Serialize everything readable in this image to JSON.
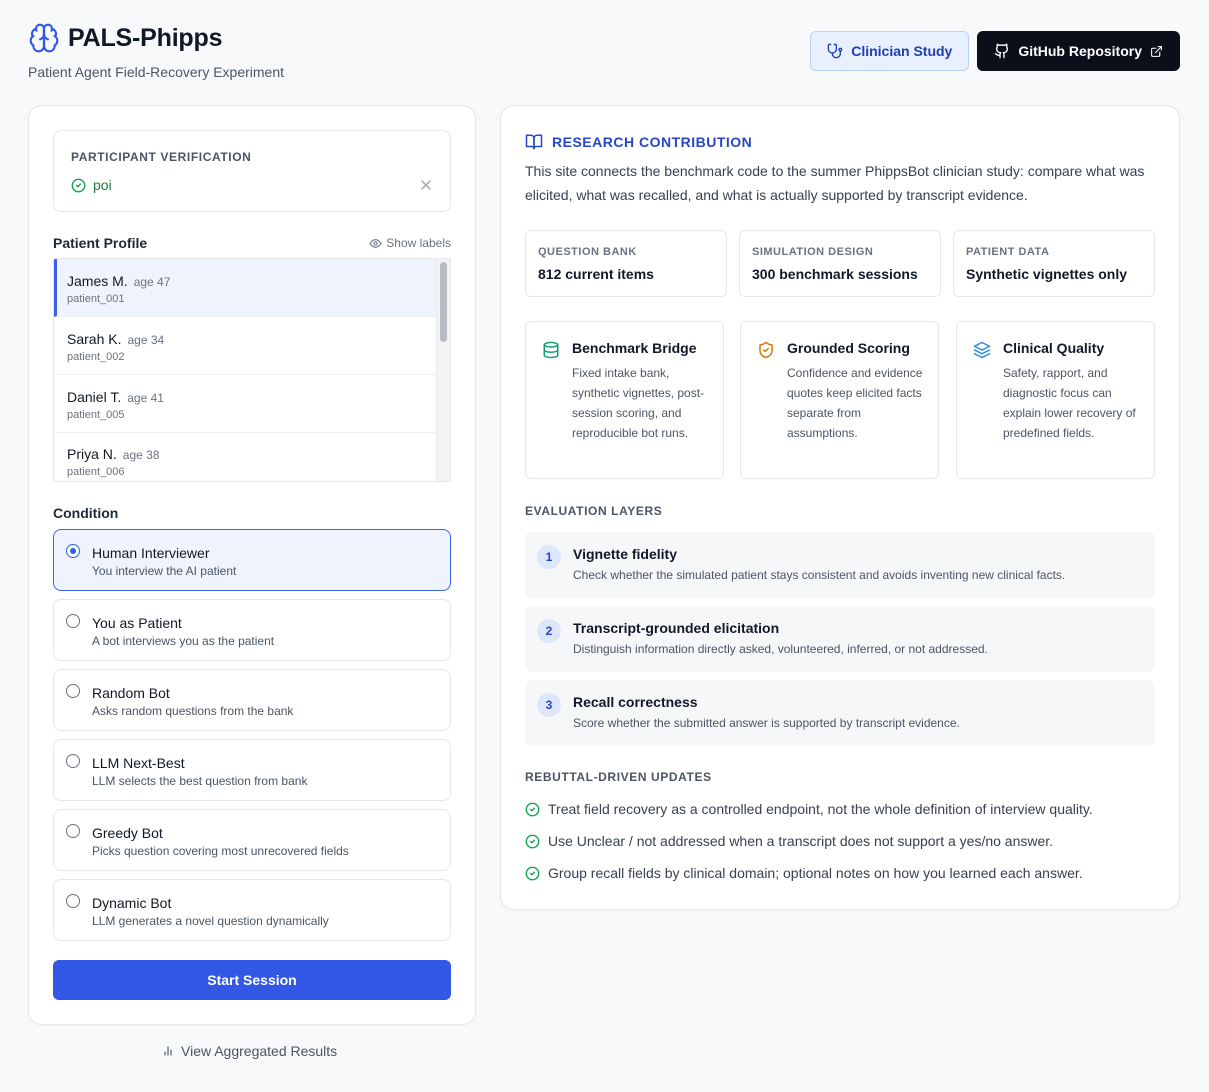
{
  "header": {
    "title": "PALS-Phipps",
    "subtitle": "Patient Agent Field-Recovery Experiment",
    "clinician_btn": "Clinician Study",
    "github_btn": "GitHub Repository"
  },
  "verification": {
    "label": "PARTICIPANT VERIFICATION",
    "value": "poi"
  },
  "patients": {
    "title": "Patient Profile",
    "show_labels": "Show labels",
    "items": [
      {
        "name": "James M.",
        "age": "age 47",
        "id": "patient_001"
      },
      {
        "name": "Sarah K.",
        "age": "age 34",
        "id": "patient_002"
      },
      {
        "name": "Daniel T.",
        "age": "age 41",
        "id": "patient_005"
      },
      {
        "name": "Priya N.",
        "age": "age 38",
        "id": "patient_006"
      }
    ]
  },
  "conditions": {
    "title": "Condition",
    "items": [
      {
        "title": "Human Interviewer",
        "desc": "You interview the AI patient"
      },
      {
        "title": "You as Patient",
        "desc": "A bot interviews you as the patient"
      },
      {
        "title": "Random Bot",
        "desc": "Asks random questions from the bank"
      },
      {
        "title": "LLM Next-Best",
        "desc": "LLM selects the best question from bank"
      },
      {
        "title": "Greedy Bot",
        "desc": "Picks question covering most unrecovered fields"
      },
      {
        "title": "Dynamic Bot",
        "desc": "LLM generates a novel question dynamically"
      }
    ]
  },
  "start_btn": "Start Session",
  "agg_link": "View Aggregated Results",
  "research": {
    "title": "RESEARCH CONTRIBUTION",
    "intro": "This site connects the benchmark code to the summer PhippsBot clinician study: compare what was elicited, what was recalled, and what is actually supported by transcript evidence.",
    "stats": [
      {
        "label": "QUESTION BANK",
        "value": "812 current items"
      },
      {
        "label": "SIMULATION DESIGN",
        "value": "300 benchmark sessions"
      },
      {
        "label": "PATIENT DATA",
        "value": "Synthetic vignettes only"
      }
    ],
    "features": [
      {
        "title": "Benchmark Bridge",
        "desc": "Fixed intake bank, synthetic vignettes, post-session scoring, and reproducible bot runs."
      },
      {
        "title": "Grounded Scoring",
        "desc": "Confidence and evidence quotes keep elicited facts separate from assumptions."
      },
      {
        "title": "Clinical Quality",
        "desc": "Safety, rapport, and diagnostic focus can explain lower recovery of predefined fields."
      }
    ],
    "eval_title": "EVALUATION LAYERS",
    "layers": [
      {
        "num": "1",
        "title": "Vignette fidelity",
        "desc": "Check whether the simulated patient stays consistent and avoids inventing new clinical facts."
      },
      {
        "num": "2",
        "title": "Transcript-grounded elicitation",
        "desc": "Distinguish information directly asked, volunteered, inferred, or not addressed."
      },
      {
        "num": "3",
        "title": "Recall correctness",
        "desc": "Score whether the submitted answer is supported by transcript evidence."
      }
    ],
    "rebuttal_title": "REBUTTAL-DRIVEN UPDATES",
    "rebuttals": [
      "Treat field recovery as a controlled endpoint, not the whole definition of interview quality.",
      "Use Unclear / not addressed when a transcript does not support a yes/no answer.",
      "Group recall fields by clinical domain; optional notes on how you learned each answer."
    ]
  },
  "colors": {
    "accent": "#3257e4",
    "accent_dark": "#2747c6",
    "success": "#15803d",
    "warning": "#d97706",
    "teal": "#0f9f6e",
    "sky": "#2b8ad6"
  }
}
